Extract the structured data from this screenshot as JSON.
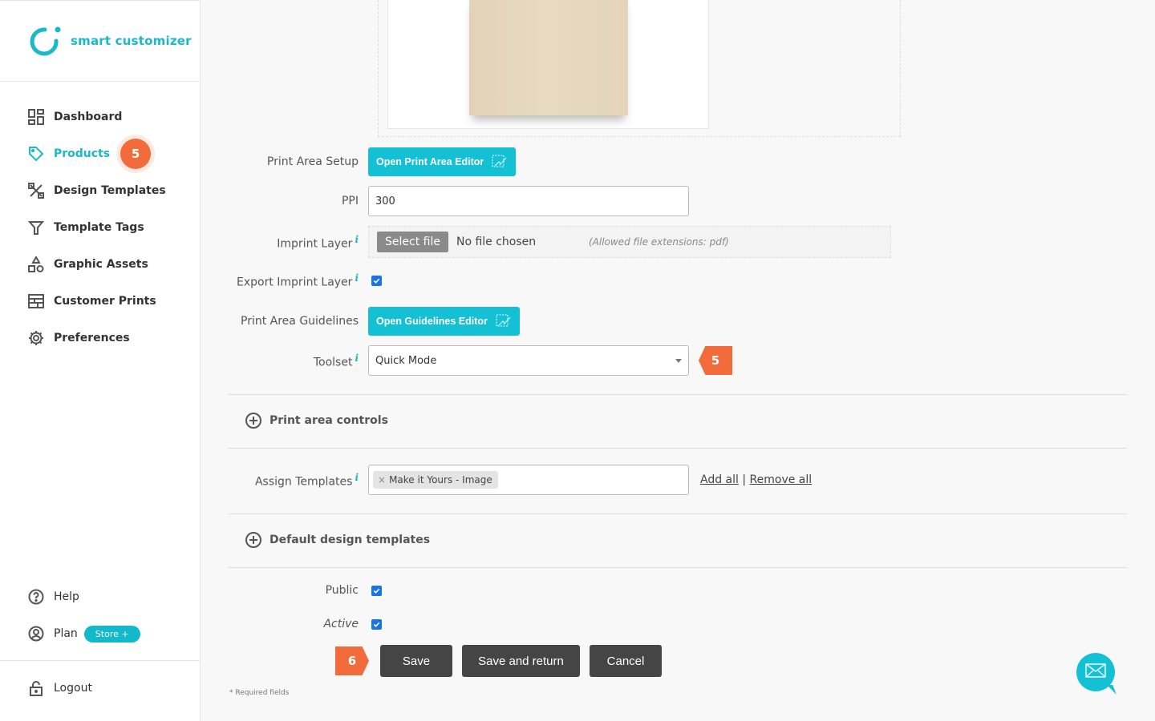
{
  "brand": {
    "name": "smart customizer",
    "accent": "#1bb8c8",
    "badge_color": "#f26b3a"
  },
  "sidebar": {
    "items": [
      {
        "label": "Dashboard",
        "icon": "dashboard-icon",
        "active": false
      },
      {
        "label": "Products",
        "icon": "tag-icon",
        "active": true,
        "badge": "5"
      },
      {
        "label": "Design Templates",
        "icon": "design-tools-icon",
        "active": false
      },
      {
        "label": "Template Tags",
        "icon": "filter-icon",
        "active": false
      },
      {
        "label": "Graphic Assets",
        "icon": "shapes-icon",
        "active": false
      },
      {
        "label": "Customer Prints",
        "icon": "prints-icon",
        "active": false
      },
      {
        "label": "Preferences",
        "icon": "gear-icon",
        "active": false
      }
    ],
    "bottom": [
      {
        "label": "Help",
        "icon": "help-icon"
      },
      {
        "label": "Plan",
        "icon": "user-circle-icon",
        "pill": "Store +"
      }
    ],
    "logout": {
      "label": "Logout",
      "icon": "lock-icon"
    }
  },
  "form": {
    "print_area_setup": {
      "label": "Print Area Setup",
      "button": "Open Print Area Editor"
    },
    "ppi": {
      "label": "PPI",
      "value": "300"
    },
    "imprint_layer": {
      "label": "Imprint Layer",
      "button": "Select file",
      "status": "No file chosen",
      "hint": "(Allowed file extensions: pdf)"
    },
    "export_imprint_layer": {
      "label": "Export Imprint Layer",
      "checked": true
    },
    "print_area_guidelines": {
      "label": "Print Area Guidelines",
      "button": "Open Guidelines Editor"
    },
    "toolset": {
      "label": "Toolset",
      "value": "Quick Mode",
      "callout": "5"
    },
    "sections": {
      "print_area_controls": "Print area controls",
      "default_design_templates": "Default design templates"
    },
    "assign_templates": {
      "label": "Assign Templates",
      "chips": [
        "Make it Yours - Image"
      ],
      "add_all": "Add all",
      "separator": "|",
      "remove_all": "Remove all"
    },
    "public": {
      "label": "Public",
      "checked": true
    },
    "active": {
      "label": "Active",
      "checked": true
    },
    "actions": {
      "callout": "6",
      "save": "Save",
      "save_return": "Save and return",
      "cancel": "Cancel"
    },
    "required_note": "* Required fields"
  }
}
